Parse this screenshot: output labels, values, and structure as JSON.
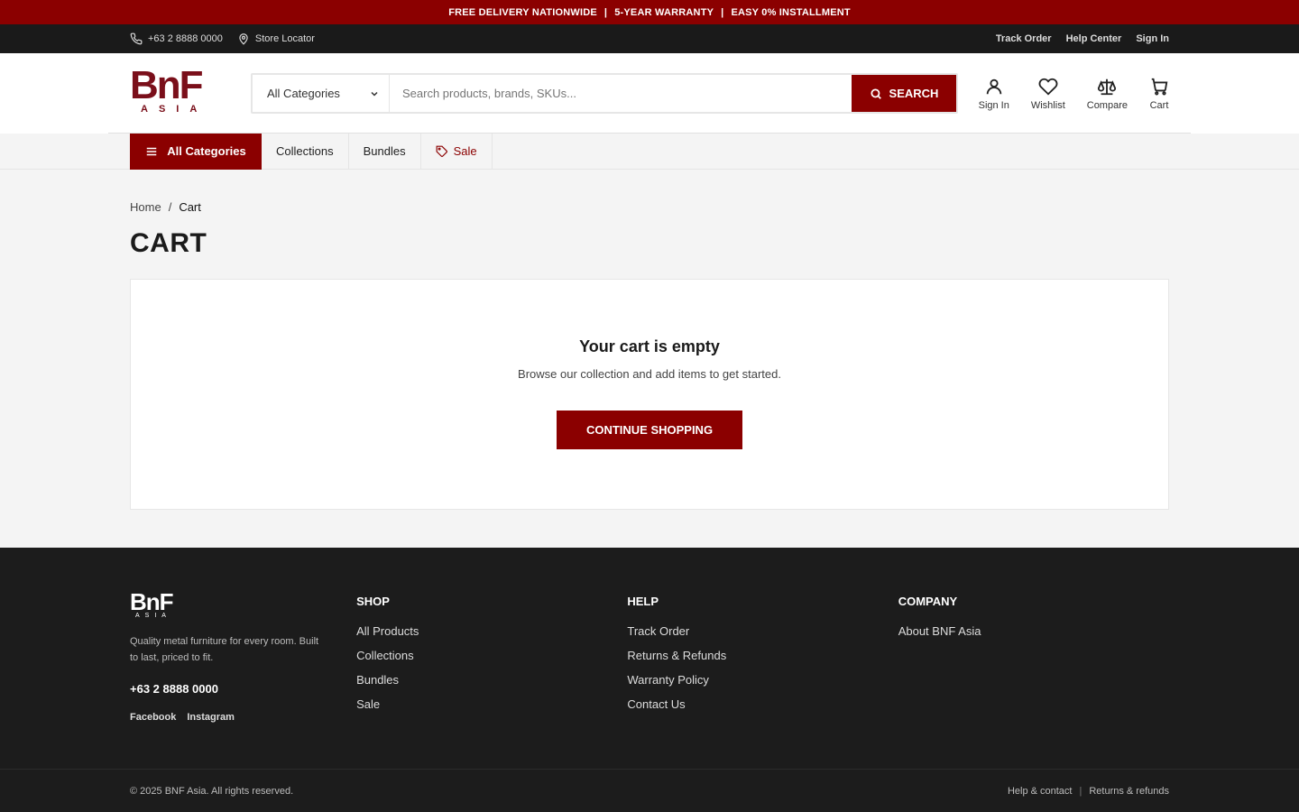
{
  "promo": {
    "items": [
      "FREE DELIVERY NATIONWIDE",
      "5-YEAR WARRANTY",
      "EASY 0% INSTALLMENT"
    ],
    "sep": "|"
  },
  "utility": {
    "phone": "+63 2 8888 0000",
    "store_locator": "Store Locator",
    "track_order": "Track Order",
    "help_center": "Help Center",
    "sign_in": "Sign In"
  },
  "header": {
    "logo": {
      "mark": "BnF",
      "sub": "ASIA"
    },
    "search": {
      "category": "All Categories",
      "placeholder": "Search products, brands, SKUs...",
      "button": "SEARCH"
    },
    "icons": {
      "sign_in": "Sign In",
      "wishlist": "Wishlist",
      "compare": "Compare",
      "cart": "Cart"
    }
  },
  "nav": {
    "all_categories": "All Categories",
    "links": [
      "Collections",
      "Bundles"
    ],
    "sale": "Sale"
  },
  "breadcrumb": {
    "home": "Home",
    "sep": "/",
    "current": "Cart"
  },
  "page": {
    "title": "CART",
    "empty_title": "Your cart is empty",
    "empty_desc": "Browse our collection and add items to get started.",
    "cta": "CONTINUE SHOPPING"
  },
  "footer": {
    "brand": {
      "mark": "BnF",
      "sub": "ASIA",
      "desc": "Quality metal furniture for every room. Built to last, priced to fit.",
      "phone": "+63 2 8888 0000",
      "social": [
        "Facebook",
        "Instagram"
      ]
    },
    "shop": {
      "title": "SHOP",
      "items": [
        "All Products",
        "Collections",
        "Bundles",
        "Sale"
      ]
    },
    "help": {
      "title": "HELP",
      "items": [
        "Track Order",
        "Returns & Refunds",
        "Warranty Policy",
        "Contact Us"
      ]
    },
    "company": {
      "title": "COMPANY",
      "items": [
        "About BNF Asia"
      ]
    },
    "copyright": "© 2025 BNF Asia. All rights reserved.",
    "bottom_links": [
      "Help & contact",
      "Returns & refunds"
    ],
    "bottom_sep": "|"
  },
  "colors": {
    "brand": "#8b0000",
    "dark": "#1c1c1c",
    "page_bg": "#f4f4f4"
  }
}
